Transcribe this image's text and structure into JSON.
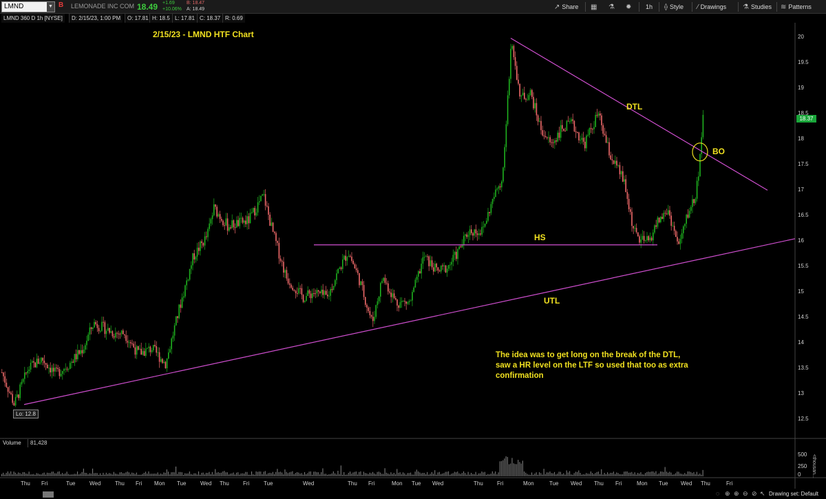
{
  "toolbar": {
    "symbol": "LMND",
    "flag": "B",
    "company": "LEMONADE INC COM",
    "last": "18.49",
    "change": "+1.69",
    "change_pct": "+10.06%",
    "bid": "B: 18.47",
    "ask": "A: 18.49",
    "share": "Share",
    "timeframe": "1h",
    "style": "Style",
    "drawings": "Drawings",
    "studies": "Studies",
    "patterns": "Patterns",
    "icons": [
      "share-icon",
      "calculator-icon",
      "flask-icon",
      "gear-icon",
      "style-icon",
      "pencil-icon",
      "studies-icon",
      "patterns-icon"
    ]
  },
  "infobar": {
    "desc": "LMND 360 D 1h [NYSE]",
    "date": "D: 2/15/23, 1:00 PM",
    "open": "O: 17.81",
    "high": "H: 18.5",
    "low": "L: 17.81",
    "close": "C: 18.37",
    "range": "R: 0.69"
  },
  "annotations": {
    "title": "2/15/23 - LMND HTF Chart",
    "dtl": "DTL",
    "bo": "BO",
    "hs": "HS",
    "utl": "UTL",
    "note": "The idea was to get long on the break of the DTL, saw a HR level on the LTF so used that too as extra confirmation"
  },
  "lo_label": "Lo: 12.8",
  "price_badge": "18.37",
  "colors": {
    "up": "#1fb21f",
    "down": "#f06a6a",
    "trendline": "#d04fd0",
    "annotation": "#f0e020",
    "badge": "#1aa63a"
  },
  "chart_data": {
    "type": "candlestick",
    "symbol": "LMND",
    "interval": "1h",
    "ylim": [
      12.35,
      20.25
    ],
    "y_ticks": [
      "20",
      "19.5",
      "19",
      "18.5",
      "18",
      "17.5",
      "17",
      "16.5",
      "16",
      "15.5",
      "15",
      "14.5",
      "14",
      "13.5",
      "13",
      "12.5"
    ],
    "x_ticks": [
      "Thu",
      "Fri",
      "Tue",
      "Wed",
      "Thu",
      "Fri",
      "Mon",
      "Tue",
      "Wed",
      "Thu",
      "Fri",
      "Tue",
      "Wed",
      "Thu",
      "Fri",
      "Mon",
      "Tue",
      "Wed",
      "Thu",
      "Fri",
      "Mon",
      "Tue",
      "Wed",
      "Thu",
      "Fri",
      "Mon",
      "Tue",
      "Wed",
      "Thu",
      "Fri"
    ],
    "price_path": [
      [
        0,
        13.5
      ],
      [
        20,
        12.8
      ],
      [
        40,
        13.5
      ],
      [
        60,
        13.7
      ],
      [
        80,
        13.4
      ],
      [
        100,
        13.6
      ],
      [
        120,
        13.9
      ],
      [
        135,
        14.4
      ],
      [
        150,
        14.3
      ],
      [
        165,
        14.2
      ],
      [
        180,
        14.2
      ],
      [
        200,
        13.8
      ],
      [
        220,
        13.9
      ],
      [
        240,
        13.6
      ],
      [
        260,
        14.7
      ],
      [
        280,
        15.7
      ],
      [
        300,
        16.1
      ],
      [
        310,
        16.65
      ],
      [
        330,
        16.3
      ],
      [
        360,
        16.4
      ],
      [
        382,
        16.9
      ],
      [
        395,
        16.2
      ],
      [
        415,
        15.3
      ],
      [
        440,
        14.9
      ],
      [
        455,
        15.0
      ],
      [
        475,
        14.9
      ],
      [
        490,
        15.4
      ],
      [
        505,
        15.8
      ],
      [
        520,
        15.3
      ],
      [
        540,
        14.4
      ],
      [
        555,
        15.3
      ],
      [
        575,
        14.8
      ],
      [
        595,
        14.8
      ],
      [
        615,
        15.7
      ],
      [
        635,
        15.4
      ],
      [
        650,
        15.5
      ],
      [
        665,
        15.8
      ],
      [
        680,
        16.2
      ],
      [
        700,
        16.2
      ],
      [
        715,
        16.8
      ],
      [
        730,
        17.3
      ],
      [
        742,
        19.95
      ],
      [
        755,
        18.8
      ],
      [
        770,
        18.9
      ],
      [
        785,
        18.2
      ],
      [
        800,
        17.9
      ],
      [
        815,
        18.2
      ],
      [
        830,
        18.3
      ],
      [
        848,
        17.9
      ],
      [
        868,
        18.5
      ],
      [
        885,
        17.7
      ],
      [
        905,
        17.2
      ],
      [
        920,
        16.2
      ],
      [
        930,
        16.0
      ],
      [
        942,
        16.0
      ],
      [
        955,
        16.4
      ],
      [
        970,
        16.6
      ],
      [
        985,
        15.9
      ],
      [
        1000,
        16.6
      ],
      [
        1010,
        16.9
      ],
      [
        1015,
        17.5
      ],
      [
        1020,
        18.37
      ]
    ],
    "trendlines": [
      {
        "name": "DTL",
        "from": [
          742,
          19.98
        ],
        "to": [
          1115,
          17.0
        ]
      },
      {
        "name": "UTL",
        "from": [
          35,
          12.8
        ],
        "to": [
          1155,
          16.05
        ]
      },
      {
        "name": "HS",
        "from": [
          456,
          15.93
        ],
        "to": [
          955,
          15.93
        ]
      }
    ],
    "breakout_marker": [
      1017,
      17.75
    ],
    "low": 12.8,
    "last_close": 18.37,
    "volume": {
      "label": "Volume",
      "value": "81,428",
      "y_ticks": [
        "500",
        "250",
        "0"
      ],
      "unit": "<thousan...",
      "ymax": 720
    }
  },
  "footer": {
    "drawing_set": "Drawing set: Default",
    "icons": [
      "bubble-icon",
      "crosshair-icon",
      "zoom-in-icon",
      "zoom-out-icon",
      "zoom-reset-icon",
      "cursor-icon"
    ]
  }
}
